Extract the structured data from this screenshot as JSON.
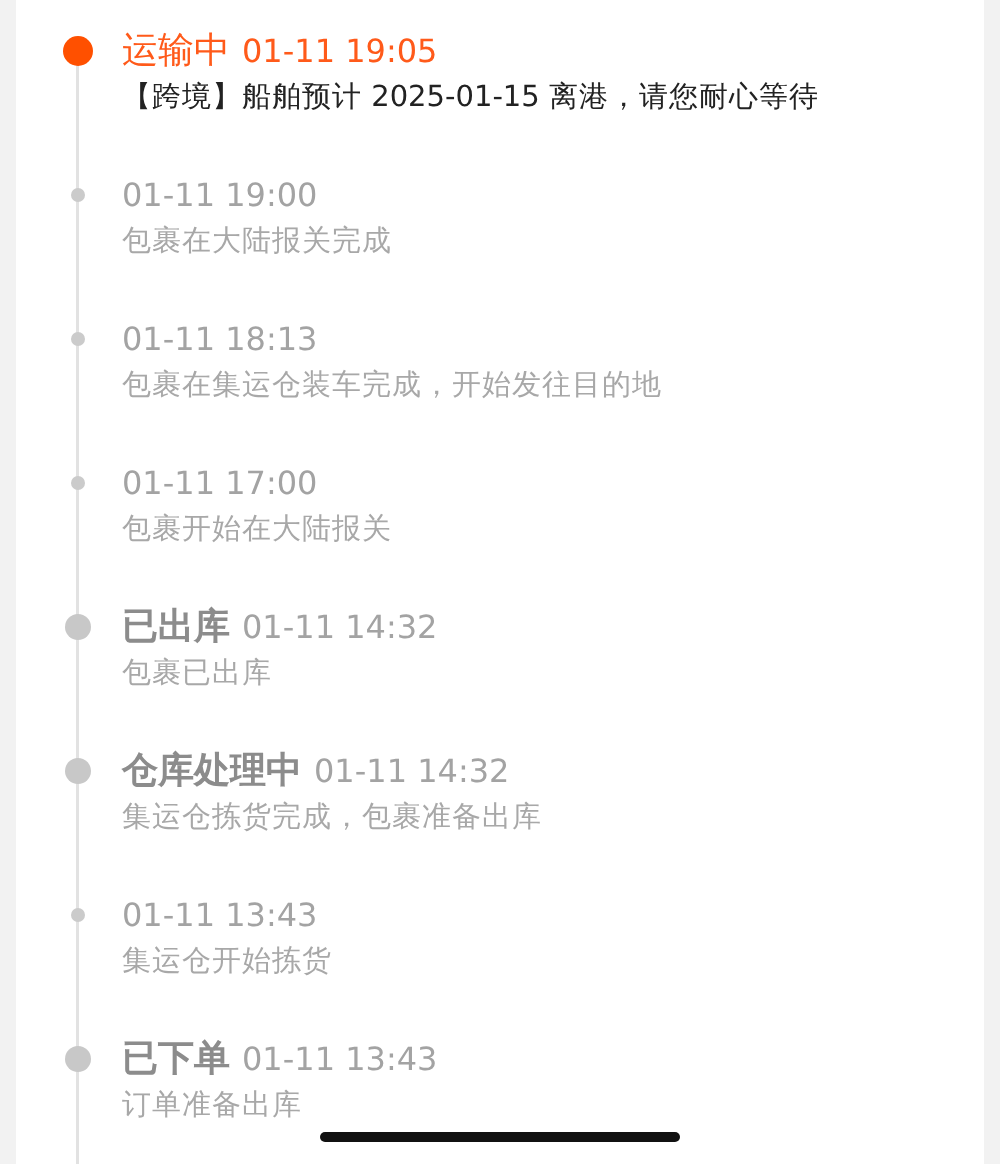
{
  "events": [
    {
      "kind": "current",
      "status": "运输中",
      "time": "01-11 19:05",
      "description": "【跨境】船舶预计 2025-01-15 离港，请您耐心等待"
    },
    {
      "kind": "update",
      "time": "01-11 19:00",
      "description": "包裹在大陆报关完成"
    },
    {
      "kind": "update",
      "time": "01-11 18:13",
      "description": "包裹在集运仓装车完成，开始发往目的地"
    },
    {
      "kind": "update",
      "time": "01-11 17:00",
      "description": "包裹开始在大陆报关"
    },
    {
      "kind": "status",
      "status": "已出库",
      "time": "01-11 14:32",
      "description": "包裹已出库"
    },
    {
      "kind": "status",
      "status": "仓库处理中",
      "time": "01-11 14:32",
      "description": "集运仓拣货完成，包裹准备出库"
    },
    {
      "kind": "update",
      "time": "01-11 13:43",
      "description": "集运仓开始拣货"
    },
    {
      "kind": "status",
      "status": "已下单",
      "time": "01-11 13:43",
      "description": "订单准备出库"
    }
  ]
}
